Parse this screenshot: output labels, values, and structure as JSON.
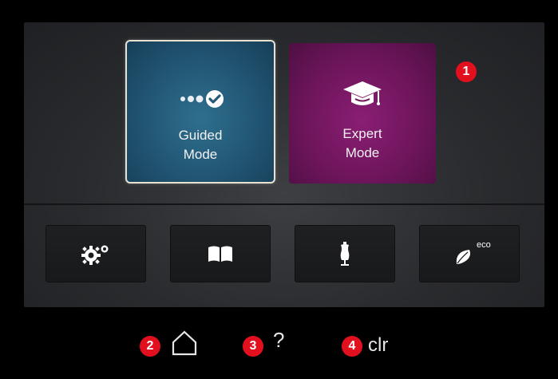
{
  "modes": {
    "guided": {
      "label_line1": "Guided",
      "label_line2": "Mode",
      "icon": "dots-check-icon"
    },
    "expert": {
      "label_line1": "Expert",
      "label_line2": "Mode",
      "icon": "graduation-cap-icon"
    }
  },
  "toolbar": [
    {
      "icon": "gears-icon"
    },
    {
      "icon": "book-icon"
    },
    {
      "icon": "dress-form-icon"
    },
    {
      "icon": "eco-leaf-icon",
      "text": "eco"
    }
  ],
  "bottom": {
    "home_icon": "home-icon",
    "help_label": "?",
    "clear_label": "clr"
  },
  "badges": [
    "1",
    "2",
    "3",
    "4"
  ],
  "colors": {
    "guided": "#235a78",
    "expert": "#6e155c",
    "badge": "#e2101f"
  }
}
